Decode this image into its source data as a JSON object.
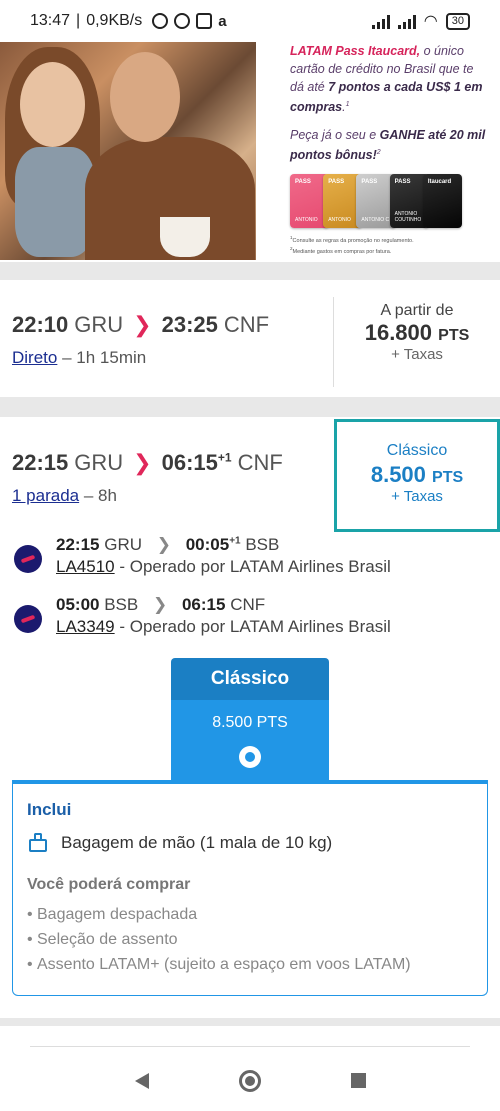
{
  "status_bar": {
    "time": "13:47",
    "speed": "0,9KB/s",
    "battery": "30"
  },
  "banner": {
    "line1_brand": "LATAM Pass Itaucard,",
    "line1_rest": " o único cartão de crédito no Brasil que te dá até ",
    "line1_bold": "7 pontos a cada US$ 1 em compras",
    "line1_end": ".",
    "line2_start": "Peça já o seu e ",
    "line2_bold": "GANHE até 20 mil pontos bônus!",
    "card_label": "PASS",
    "card_brand": "Itaucard",
    "card_names": [
      "ANTONIO",
      "ANTONIO",
      "ANTONIO C",
      "ANTONIO COUTINHO",
      ""
    ],
    "fineprint1": "Consulte as regras da promoção no regulamento.",
    "fineprint2": "Mediante gastos em compras por fatura."
  },
  "flights": [
    {
      "dep_time": "22:10",
      "dep_ap": "GRU",
      "arr_time": "23:25",
      "arr_ap": "CNF",
      "stops": "Direto",
      "duration": "– 1h 15min",
      "price_label": "A partir de",
      "price": "16.800",
      "price_unit": "PTS",
      "taxes": "+ Taxas"
    },
    {
      "dep_time": "22:15",
      "dep_ap": "GRU",
      "arr_time": "06:15",
      "arr_plus": "+1",
      "arr_ap": "CNF",
      "stops": "1 parada",
      "duration": "– 8h",
      "price_label": "Clássico",
      "price": "8.500",
      "price_unit": "PTS",
      "taxes": "+ Taxas",
      "legs": [
        {
          "dep_time": "22:15",
          "dep_ap": "GRU",
          "arr_time": "00:05",
          "arr_plus": "+1",
          "arr_ap": "BSB",
          "flight": "LA4510",
          "operator": " - Operado por LATAM Airlines Brasil"
        },
        {
          "dep_time": "05:00",
          "dep_ap": "BSB",
          "arr_time": "06:15",
          "arr_plus": "",
          "arr_ap": "CNF",
          "flight": "LA3349",
          "operator": " - Operado por LATAM Airlines Brasil"
        }
      ]
    }
  ],
  "fare": {
    "name": "Clássico",
    "price": "8.500 PTS",
    "includes_title": "Inclui",
    "includes": [
      "Bagagem de mão (1 mala de 10 kg)"
    ],
    "buy_title": "Você poderá comprar",
    "buy_items": [
      "Bagagem despachada",
      "Seleção de assento",
      "Assento LATAM+ (sujeito a espaço em voos LATAM)"
    ]
  },
  "colors": {
    "accent_pink": "#e0275a",
    "brand_blue": "#1b7fc4",
    "selected_teal": "#1aa3a8",
    "fare_blue": "#2196e6"
  }
}
